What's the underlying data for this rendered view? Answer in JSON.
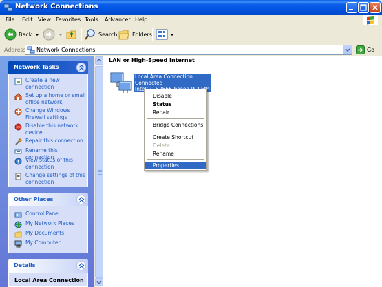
{
  "window": {
    "title": "Network Connections"
  },
  "menubar": {
    "items": [
      "File",
      "Edit",
      "View",
      "Favorites",
      "Tools",
      "Advanced",
      "Help"
    ]
  },
  "toolbar": {
    "back": "Back",
    "search": "Search",
    "folders": "Folders"
  },
  "address": {
    "label": "Address",
    "value": "Network Connections",
    "go": "Go"
  },
  "network_tasks": {
    "title": "Network Tasks",
    "items": [
      "Create a new connection",
      "Set up a home or small office network",
      "Change Windows Firewall settings",
      "Disable this network device",
      "Repair this connection",
      "Rename this connection",
      "View status of this connection",
      "Change settings of this connection"
    ]
  },
  "other_places": {
    "title": "Other Places",
    "items": [
      "Control Panel",
      "My Network Places",
      "My Documents",
      "My Computer"
    ]
  },
  "details": {
    "title": "Details",
    "item": "Local Area Connection"
  },
  "content": {
    "group_header": "LAN or High-Speed Internet",
    "connection": {
      "name": "Local Area Connection",
      "status": "Connected",
      "device": "Intel(R) 82566-based PCI Etherm..."
    }
  },
  "context_menu": {
    "items": [
      "Disable",
      "Status",
      "Repair",
      "Bridge Connections",
      "Create Shortcut",
      "Delete",
      "Rename",
      "Properties"
    ]
  },
  "colors": {
    "title_bar": "#0054E3",
    "selection": "#316AC5",
    "task_link": "#215DC6",
    "left_pane": "#6375D6"
  }
}
